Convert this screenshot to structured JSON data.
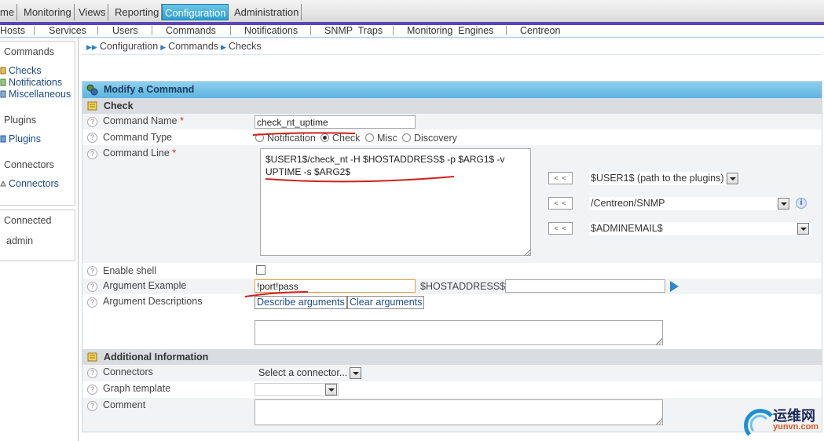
{
  "topmenu": {
    "items": [
      "me",
      "Monitoring",
      "Views",
      "Reporting",
      "Configuration",
      "Administration"
    ],
    "active": "Configuration"
  },
  "submenu": {
    "items": [
      "Hosts",
      "Services",
      "Users",
      "Commands",
      "Notifications",
      "SNMP  Traps",
      "Monitoring  Engines",
      "Centreon"
    ]
  },
  "sidebar": {
    "commands_title": "Commands",
    "commands_items": [
      "Checks",
      "Notifications",
      "Miscellaneous"
    ],
    "plugins_title": "Plugins",
    "plugins_items": [
      "Plugins"
    ],
    "connectors_title": "Connectors",
    "connectors_items": [
      "Connectors"
    ],
    "connected_title": "Connected",
    "connected_user": "admin"
  },
  "breadcrumb": [
    "Configuration",
    "Commands",
    "Checks"
  ],
  "form": {
    "title": "Modify a Command",
    "section_check": "Check",
    "command_name_label": "Command Name",
    "command_name_value": "check_nt_uptime",
    "command_type_label": "Command Type",
    "command_types": [
      "Notification",
      "Check",
      "Misc",
      "Discovery"
    ],
    "command_type_selected": "Check",
    "command_line_label": "Command Line",
    "command_line_value": "$USER1$/check_nt -H $HOSTADDRESS$ -p $ARG1$ -v UPTIME -s $ARG2$",
    "macro_button": "< <",
    "macros": [
      "$USER1$ (path to the plugins)",
      "/Centreon/SNMP",
      "$ADMINEMAIL$"
    ],
    "enable_shell_label": "Enable shell",
    "argument_example_label": "Argument Example",
    "argument_example_value": "!port!pass",
    "hostaddress_label": "$HOSTADDRESS$",
    "hostaddress_value": "",
    "argument_descriptions_label": "Argument Descriptions",
    "describe_button": "Describe arguments",
    "clear_button": "Clear arguments",
    "section_additional": "Additional Information",
    "connectors_label": "Connectors",
    "connectors_value": "Select a connector...",
    "graph_template_label": "Graph template",
    "graph_template_value": "",
    "comment_label": "Comment",
    "required_mark": "*",
    "help_mark": "?",
    "info_mark": "i"
  },
  "watermark": {
    "cn": "运维网",
    "url": "yunvn.com"
  },
  "colors": {
    "accent": "#2d9fd0",
    "purple_bar": "#5a46b4",
    "annotation_red": "#d0201e"
  }
}
